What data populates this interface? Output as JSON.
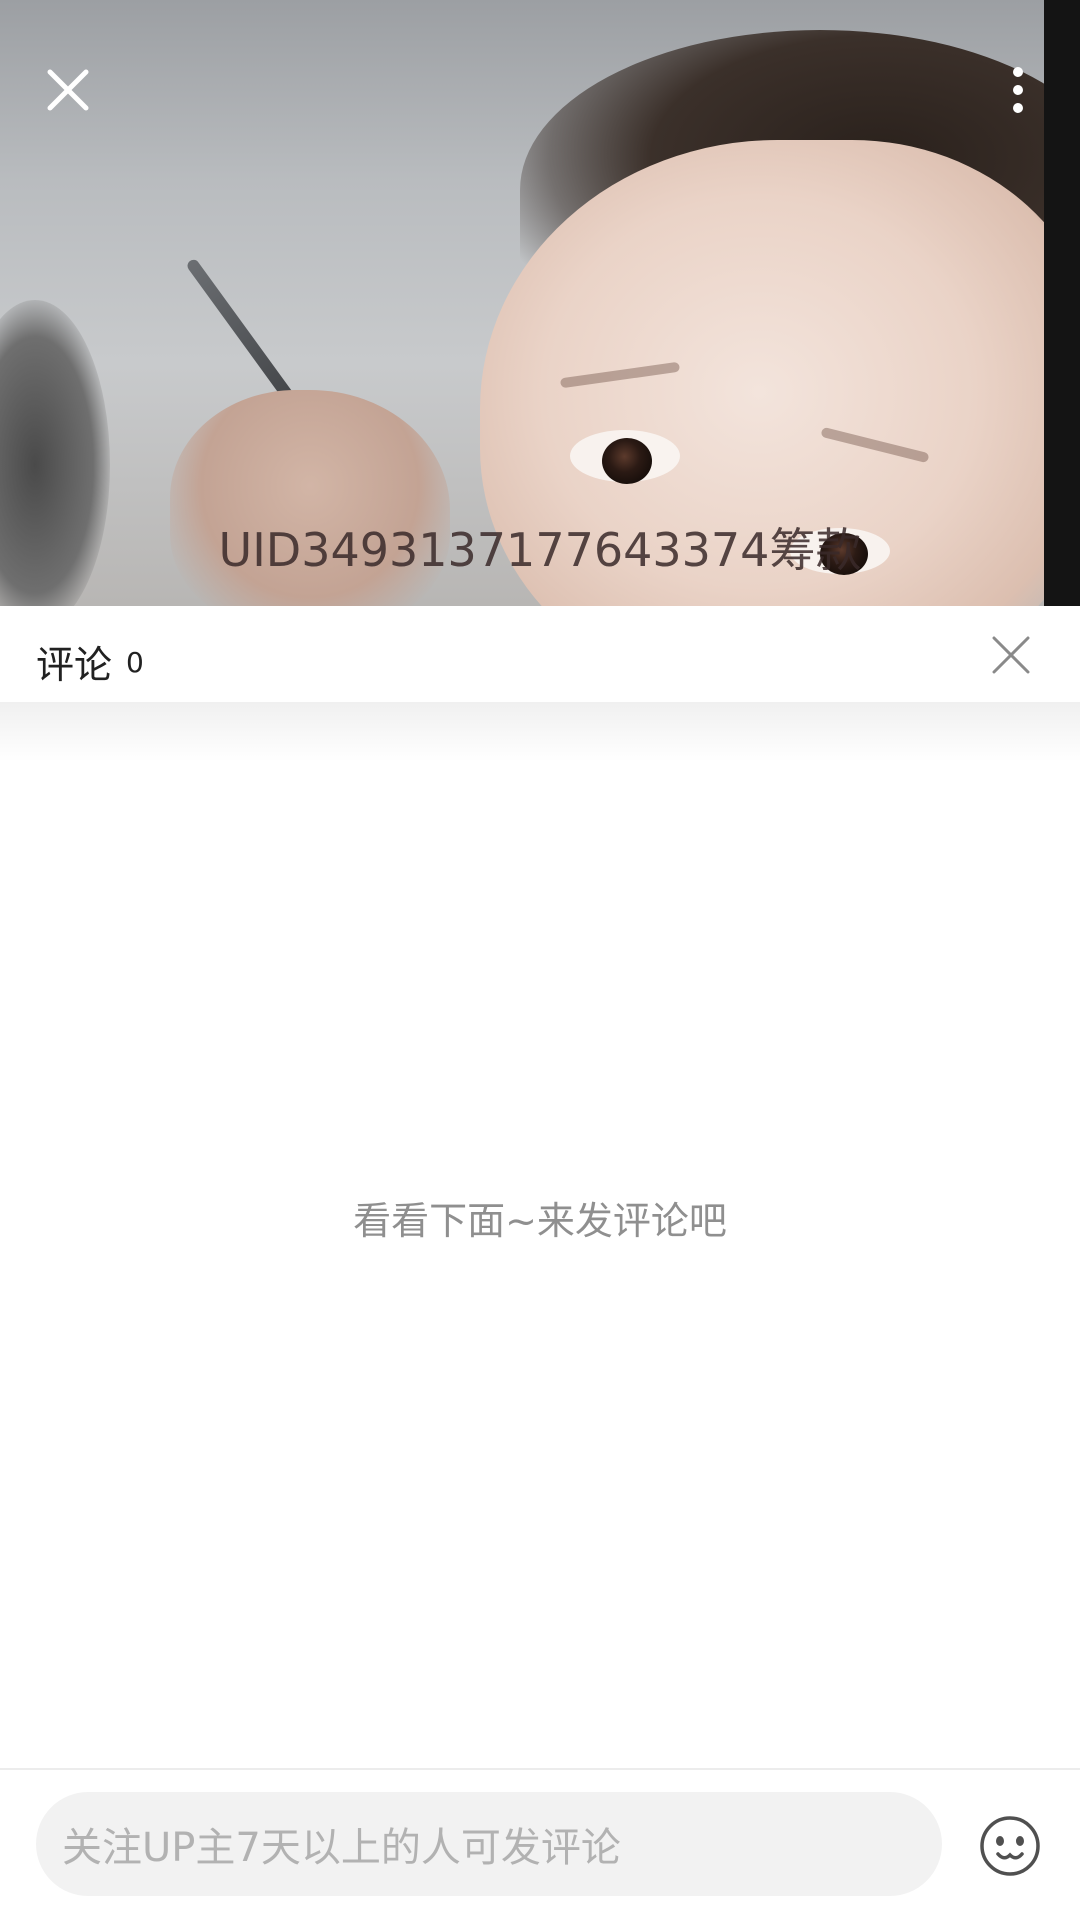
{
  "video": {
    "watermark_text": "UID3493137177643374筹款",
    "close_icon": "close-icon",
    "more_icon": "more-vertical-icon"
  },
  "comments": {
    "title": "评论",
    "count": "0",
    "close_icon": "close-icon",
    "empty_hint": "看看下面~来发评论吧"
  },
  "input": {
    "placeholder": "关注UP主7天以上的人可发评论",
    "emoji_icon": "emoji-face-icon"
  },
  "colors": {
    "panel_background": "#ffffff",
    "input_background": "#f2f2f2",
    "hint_text": "#8f8f8f",
    "placeholder_text": "#b2b2b2"
  }
}
